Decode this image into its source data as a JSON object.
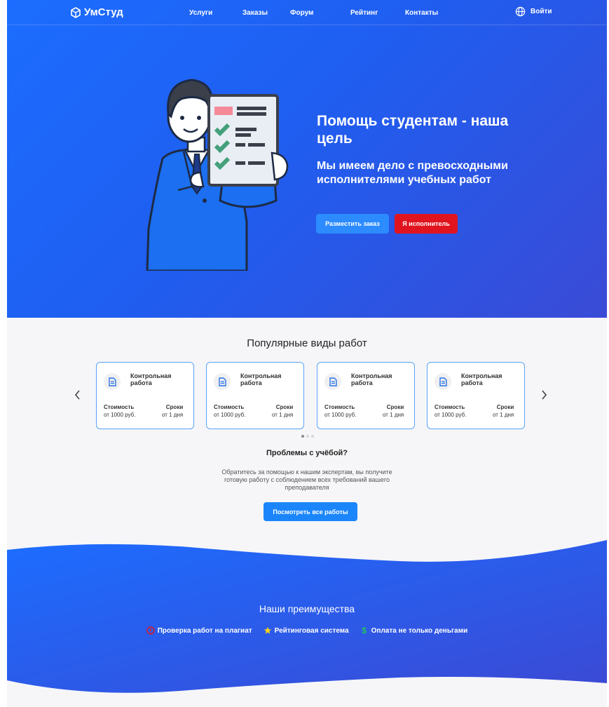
{
  "nav": {
    "logo": "УмСтуд",
    "links": [
      {
        "label": "Услуги"
      },
      {
        "label": "Заказы"
      },
      {
        "label": "Форум"
      },
      {
        "label": "Рейтинг"
      },
      {
        "label": "Контакты"
      }
    ],
    "login_label": "Войти",
    "login_icon": "globe-icon"
  },
  "hero": {
    "title": "Помощь студентам - наша цель",
    "subtitle": "Мы имеем дело с превосходными исполнителями учебных работ",
    "order_button": "Разместить заказ",
    "executor_button": "Я исполнитель",
    "colors": {
      "primary": "#1c6dff",
      "secondary_button": "#e0141e",
      "order_button": "#2b8bff"
    }
  },
  "popular": {
    "title": "Популярные виды работ",
    "cards": [
      {
        "title": "Контрольная работа",
        "price_label": "Стоимость",
        "price": "от 1000 руб.",
        "term_label": "Сроки",
        "term": "от 1 дня"
      },
      {
        "title": "Контрольная работа",
        "price_label": "Стоимость",
        "price": "от 1000 руб.",
        "term_label": "Сроки",
        "term": "от 1 дня"
      },
      {
        "title": "Контрольная работа",
        "price_label": "Стоимость",
        "price": "от 1000 руб.",
        "term_label": "Сроки",
        "term": "от 1 дня"
      },
      {
        "title": "Контрольная работа",
        "price_label": "Стоимость",
        "price": "от 1000 руб.",
        "term_label": "Сроки",
        "term": "от 1 дня"
      }
    ],
    "prev_icon": "chevron-left-icon",
    "next_icon": "chevron-right-icon",
    "carousel_active_dot": 1
  },
  "problems": {
    "title": "Проблемы с учёбой?",
    "text": "Обратитесь за помощью к нашим экспертам, вы получите готовую работу с соблюдением всех требований вашего преподавателя",
    "button": "Посмотреть все работы"
  },
  "advantages": {
    "title": "Наши преимущества",
    "items": [
      {
        "label": "Проверка работ на плагиат",
        "icon": "alert-circle-icon",
        "color": "#e0141e"
      },
      {
        "label": "Рейтинговая система",
        "icon": "star-icon",
        "color": "#f7d21a"
      },
      {
        "label": "Оплата не только деньгами",
        "icon": "dollar-icon",
        "color": "#22c55e"
      }
    ]
  }
}
